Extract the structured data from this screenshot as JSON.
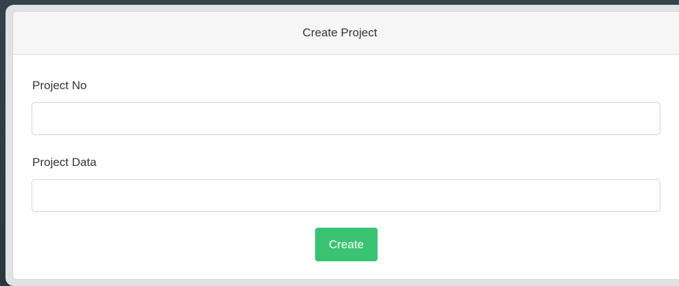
{
  "dialog": {
    "title": "Create Project"
  },
  "form": {
    "fields": [
      {
        "label": "Project No",
        "value": "",
        "placeholder": ""
      },
      {
        "label": "Project Data",
        "value": "",
        "placeholder": ""
      }
    ],
    "submit_label": "Create"
  },
  "colors": {
    "backdrop": "#2d3a42",
    "header_bg": "#f6f6f6",
    "button_bg": "#3ac373",
    "text": "#333333"
  }
}
